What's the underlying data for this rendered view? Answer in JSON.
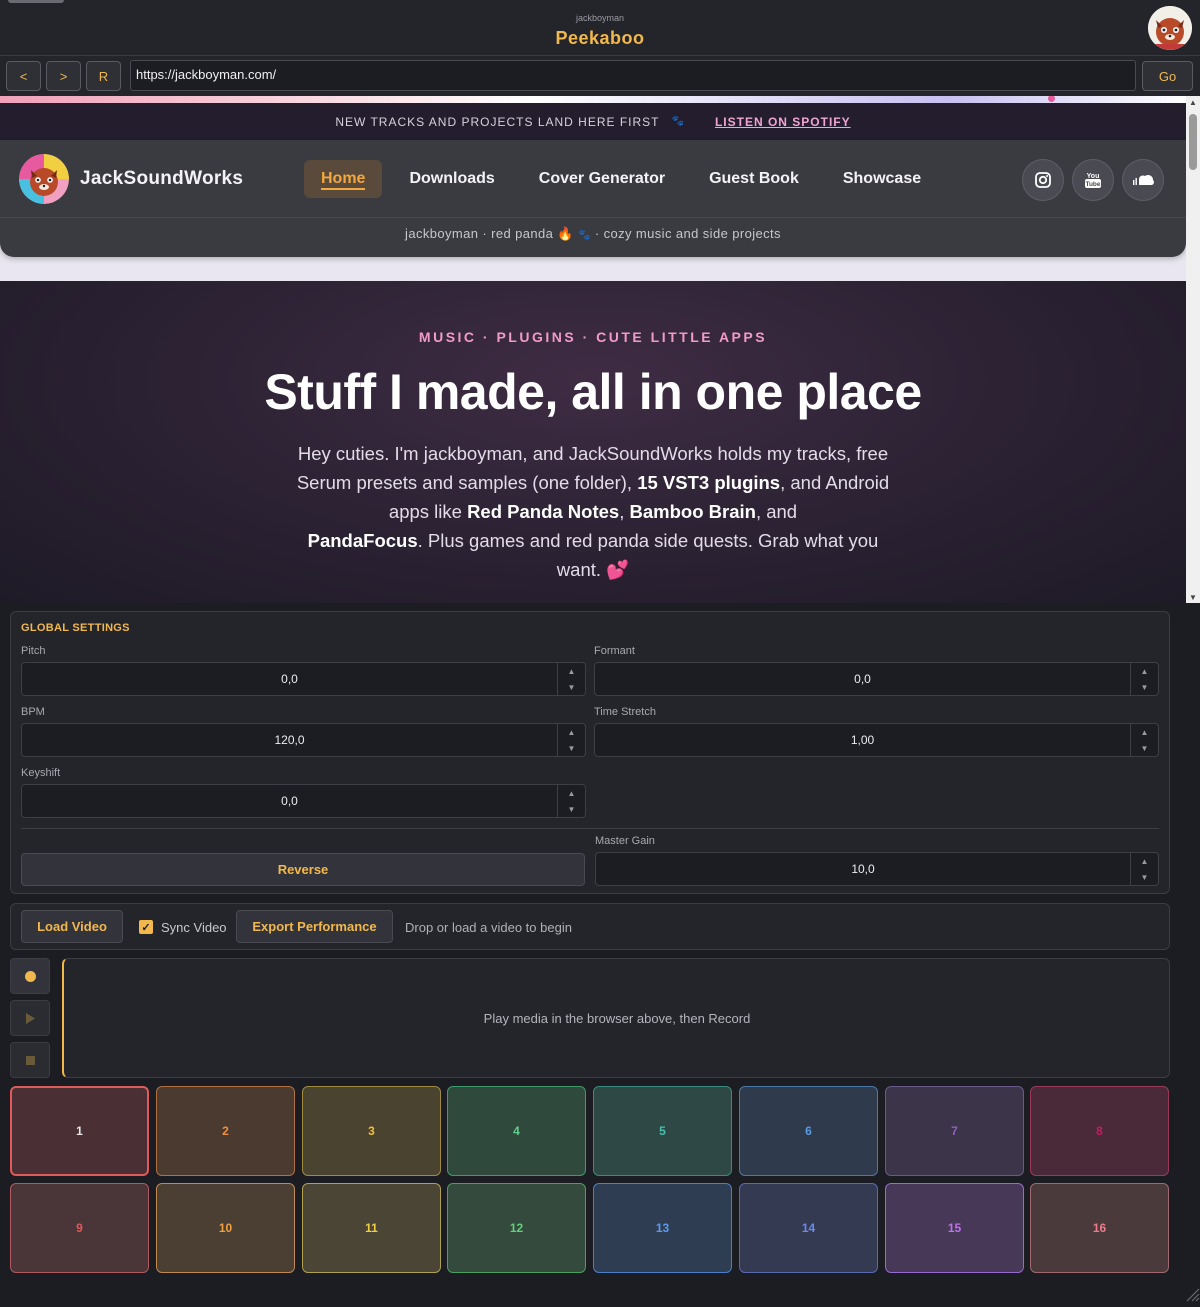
{
  "window": {
    "author": "jackboyman",
    "title": "Peekaboo"
  },
  "toolbar": {
    "back_label": "<",
    "forward_label": ">",
    "reload_label": "R",
    "url": "https://jackboyman.com/",
    "go_label": "Go"
  },
  "site": {
    "announcement": "NEW TRACKS AND PROJECTS LAND HERE FIRST",
    "announcement_link": "LISTEN ON SPOTIFY",
    "name": "JackSoundWorks",
    "nav": [
      "Home",
      "Downloads",
      "Cover Generator",
      "Guest Book",
      "Showcase"
    ],
    "social_icons": [
      "instagram-icon",
      "youtube-icon",
      "soundcloud-icon"
    ],
    "tagline_a": "jackboyman · red panda",
    "tagline_b": "· cozy music and side projects",
    "hero": {
      "kicker": "MUSIC · PLUGINS · CUTE LITTLE APPS",
      "title": "Stuff I made, all in one place",
      "body_1": "Hey cuties. I'm jackboyman, and JackSoundWorks holds my tracks, free Serum presets and samples (one folder), ",
      "body_bold_1": "15 VST3 plugins",
      "body_2": ", and Android apps like ",
      "body_bold_2": "Red Panda Notes",
      "body_3": ", ",
      "body_bold_3": "Bamboo Brain",
      "body_4": ", and ",
      "body_bold_4": "PandaFocus",
      "body_5": ". Plus games and red panda side quests. Grab what you want. ",
      "emoji": "💕"
    }
  },
  "settings": {
    "title": "GLOBAL SETTINGS",
    "pitch": {
      "label": "Pitch",
      "value": "0,0"
    },
    "formant": {
      "label": "Formant",
      "value": "0,0"
    },
    "bpm": {
      "label": "BPM",
      "value": "120,0"
    },
    "time_stretch": {
      "label": "Time Stretch",
      "value": "1,00"
    },
    "keyshift": {
      "label": "Keyshift",
      "value": "0,0"
    },
    "master_gain": {
      "label": "Master Gain",
      "value": "10,0"
    },
    "reverse_label": "Reverse"
  },
  "video": {
    "load_label": "Load Video",
    "sync_label": "Sync Video",
    "sync_checked": true,
    "export_label": "Export Performance",
    "status": "Drop or load a video to begin"
  },
  "timeline": {
    "message": "Play media in the browser above, then Record"
  },
  "pads": [
    {
      "label": "1",
      "bg": "#4a3034",
      "border": "#e05a5a",
      "text": "#e6e6ea"
    },
    {
      "label": "2",
      "bg": "#4b3a30",
      "border": "#b07040",
      "text": "#f09040"
    },
    {
      "label": "3",
      "bg": "#4a4330",
      "border": "#a08a40",
      "text": "#f0c040"
    },
    {
      "label": "4",
      "bg": "#2f4a3c",
      "border": "#3f9a6a",
      "text": "#5fd08a"
    },
    {
      "label": "5",
      "bg": "#2e4845",
      "border": "#3a8a80",
      "text": "#4ac0b0"
    },
    {
      "label": "6",
      "bg": "#2f3b4c",
      "border": "#4a78a8",
      "text": "#5a9ae0"
    },
    {
      "label": "7",
      "bg": "#3c3448",
      "border": "#6a5a8a",
      "text": "#9060c0"
    },
    {
      "label": "8",
      "bg": "#4a2a38",
      "border": "#9a3a5a",
      "text": "#c02060"
    },
    {
      "label": "9",
      "bg": "#4a3538",
      "border": "#b05a60",
      "text": "#e05a5a"
    },
    {
      "label": "10",
      "bg": "#4b3e33",
      "border": "#c08a50",
      "text": "#f0a040"
    },
    {
      "label": "11",
      "bg": "#4a4535",
      "border": "#b0a050",
      "text": "#f0d040"
    },
    {
      "label": "12",
      "bg": "#344a3c",
      "border": "#4aa060",
      "text": "#5fd07a"
    },
    {
      "label": "13",
      "bg": "#2f3d52",
      "border": "#4a80c8",
      "text": "#5a9af0"
    },
    {
      "label": "14",
      "bg": "#343a52",
      "border": "#5a6ab0",
      "text": "#6a8af0"
    },
    {
      "label": "15",
      "bg": "#463856",
      "border": "#9a6ad0",
      "text": "#c070f0"
    },
    {
      "label": "16",
      "bg": "#4a3a3c",
      "border": "#a06a70",
      "text": "#f07a8a"
    }
  ]
}
